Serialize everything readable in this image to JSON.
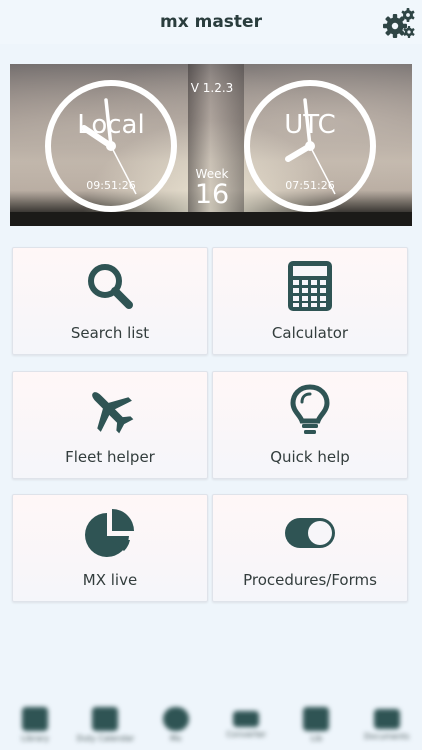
{
  "header": {
    "title": "mx master",
    "settings_icon": "gear-icon"
  },
  "hero": {
    "version": "V 1.2.3",
    "local_clock": {
      "label": "Local",
      "time": "09:51:26"
    },
    "utc_clock": {
      "label": "UTC",
      "time": "07:51:26"
    },
    "week_label": "Week",
    "week_number": "16"
  },
  "tiles": [
    {
      "label": "Search list",
      "icon": "search-icon"
    },
    {
      "label": "Calculator",
      "icon": "calculator-icon"
    },
    {
      "label": "Fleet helper",
      "icon": "airplane-icon"
    },
    {
      "label": "Quick help",
      "icon": "lightbulb-icon"
    },
    {
      "label": "MX live",
      "icon": "pie-chart-icon"
    },
    {
      "label": "Procedures/Forms",
      "icon": "toggle-icon"
    }
  ],
  "bottom_nav": [
    {
      "label": "Library",
      "icon": "library-icon"
    },
    {
      "label": "Duty Calendar",
      "icon": "calendar-icon"
    },
    {
      "label": "Mx",
      "icon": "cloud-icon"
    },
    {
      "label": "Converter",
      "icon": "money-icon"
    },
    {
      "label": "Lib",
      "icon": "grid-icon"
    },
    {
      "label": "Documents",
      "icon": "mail-icon"
    }
  ],
  "colors": {
    "accent": "#2f5454",
    "background": "#eef5fb"
  }
}
